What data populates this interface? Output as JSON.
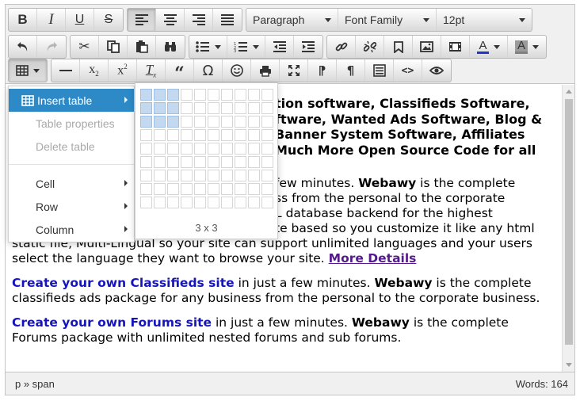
{
  "toolbar": {
    "format_select": "Paragraph",
    "font_family_select": "Font Family",
    "font_size_select": "12pt",
    "text_color": "#2433c9",
    "bg_color": "#808080"
  },
  "menu": {
    "insert_table": "Insert table",
    "table_properties": "Table properties",
    "delete_table": "Delete table",
    "cell": "Cell",
    "row": "Row",
    "column": "Column"
  },
  "grid": {
    "label": "3 x 3",
    "rows": 9,
    "cols": 10,
    "selected_rows": 3,
    "selected_cols": 3
  },
  "content": {
    "heading_lines": [
      "tion software, Classifieds  Software,",
      "ftware, Wanted Ads Software, Blog &",
      "Banner System Software, Affiliates",
      "Much More Open Source Code for all"
    ],
    "p1_lines": [
      "few minutes. ",
      "ss from the personal to the corporate",
      "L database backend for the highest",
      "te based so you customize it like any html"
    ],
    "p1_brand": "Webawy",
    "p1_rest": " is the complete",
    "p1_line5": "static file, Multi-Lingual so your site can support unlimited languages and your users",
    "p1_line6": "select the language they want to browse your site. ",
    "p1_more": "More Details",
    "p2_link": "Create your own Classifieds site",
    "p2_mid": " in just a few minutes. ",
    "p2_brand": "Webawy",
    "p2_rest": " is the complete classifieds ads package for any business from the personal to the corporate business.",
    "p3_link": "Create your own Forums site",
    "p3_mid": " in just a few minutes. ",
    "p3_brand": "Webawy",
    "p3_rest": " is the complete Forums package with unlimited nested forums and sub forums."
  },
  "status": {
    "path": "p » span",
    "words": "Words: 164"
  }
}
